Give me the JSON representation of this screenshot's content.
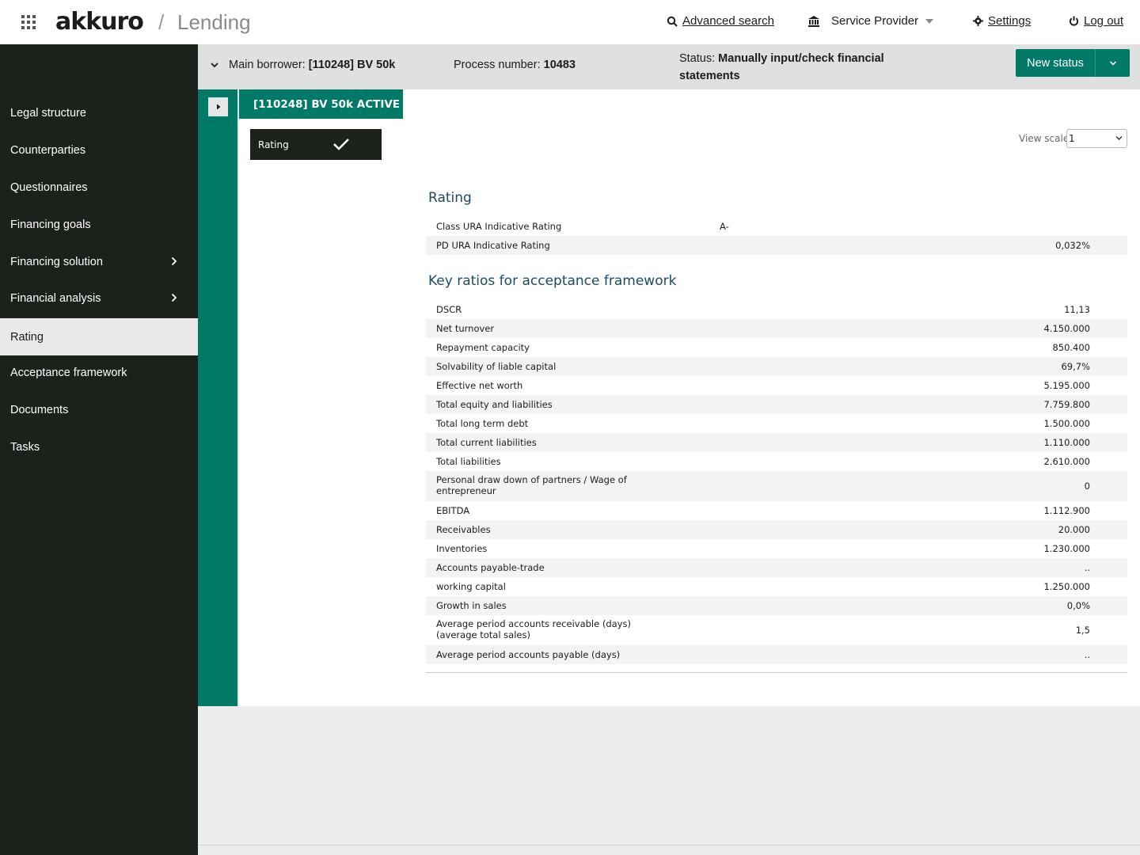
{
  "header": {
    "brand": "akkuro",
    "separator": "/",
    "app_name": "Lending",
    "advanced_search": "Advanced search",
    "service_provider": "Service Provider",
    "settings": "Settings",
    "logout": "Log out"
  },
  "sidebar": {
    "items": [
      {
        "label": "Legal structure",
        "active": false,
        "has_children": false
      },
      {
        "label": "Counterparties",
        "active": false,
        "has_children": false
      },
      {
        "label": "Questionnaires",
        "active": false,
        "has_children": false
      },
      {
        "label": "Financing goals",
        "active": false,
        "has_children": false
      },
      {
        "label": "Financing solution",
        "active": false,
        "has_children": true
      },
      {
        "label": "Financial analysis",
        "active": false,
        "has_children": true
      },
      {
        "label": "Rating",
        "active": true,
        "has_children": false
      },
      {
        "label": "Acceptance framework",
        "active": false,
        "has_children": false
      },
      {
        "label": "Documents",
        "active": false,
        "has_children": false
      },
      {
        "label": "Tasks",
        "active": false,
        "has_children": false
      }
    ]
  },
  "context": {
    "borrower_label": "Main borrower:",
    "borrower_value": "[110248] BV 50k",
    "process_label": "Process number:",
    "process_value": "10483",
    "status_label": "Status:",
    "status_value": "Manually input/check financial statements",
    "new_status_button": "New status"
  },
  "entity": {
    "tab_label": "[110248] BV 50k ACTIVE",
    "chip_label": "Rating"
  },
  "view_scale": {
    "label": "View scale",
    "value": "1"
  },
  "rating_section": {
    "title": "Rating",
    "rows": [
      {
        "label": "Class URA Indicative Rating",
        "value": "A-"
      },
      {
        "label": "PD URA Indicative Rating",
        "value": "0,032%"
      }
    ]
  },
  "key_ratios_section": {
    "title": "Key ratios for acceptance framework",
    "rows": [
      {
        "label": "DSCR",
        "value": "11,13"
      },
      {
        "label": "Net turnover",
        "value": "4.150.000"
      },
      {
        "label": "Repayment capacity",
        "value": "850.400"
      },
      {
        "label": "Solvability of liable capital",
        "value": "69,7%"
      },
      {
        "label": "Effective net worth",
        "value": "5.195.000"
      },
      {
        "label": "Total equity and liabilities",
        "value": "7.759.800"
      },
      {
        "label": "Total long term debt",
        "value": "1.500.000"
      },
      {
        "label": "Total current liabilities",
        "value": "1.110.000"
      },
      {
        "label": "Total liabilities",
        "value": "2.610.000"
      },
      {
        "label": "Personal draw down of partners / Wage of entrepreneur",
        "value": "0"
      },
      {
        "label": "EBITDA",
        "value": "1.112.900"
      },
      {
        "label": "Receivables",
        "value": "20.000"
      },
      {
        "label": "Inventories",
        "value": "1.230.000"
      },
      {
        "label": "Accounts payable-trade",
        "value": ".."
      },
      {
        "label": "working capital",
        "value": "1.250.000"
      },
      {
        "label": "Growth in sales",
        "value": "0,0%"
      },
      {
        "label": "Average period accounts receivable (days) (average total sales)",
        "value": "1,5"
      },
      {
        "label": "Average period accounts payable (days)",
        "value": ".."
      }
    ]
  },
  "colors": {
    "brand_green": "#007a66",
    "sidebar_bg": "#1b221c",
    "section_title": "#1e4a5e"
  }
}
